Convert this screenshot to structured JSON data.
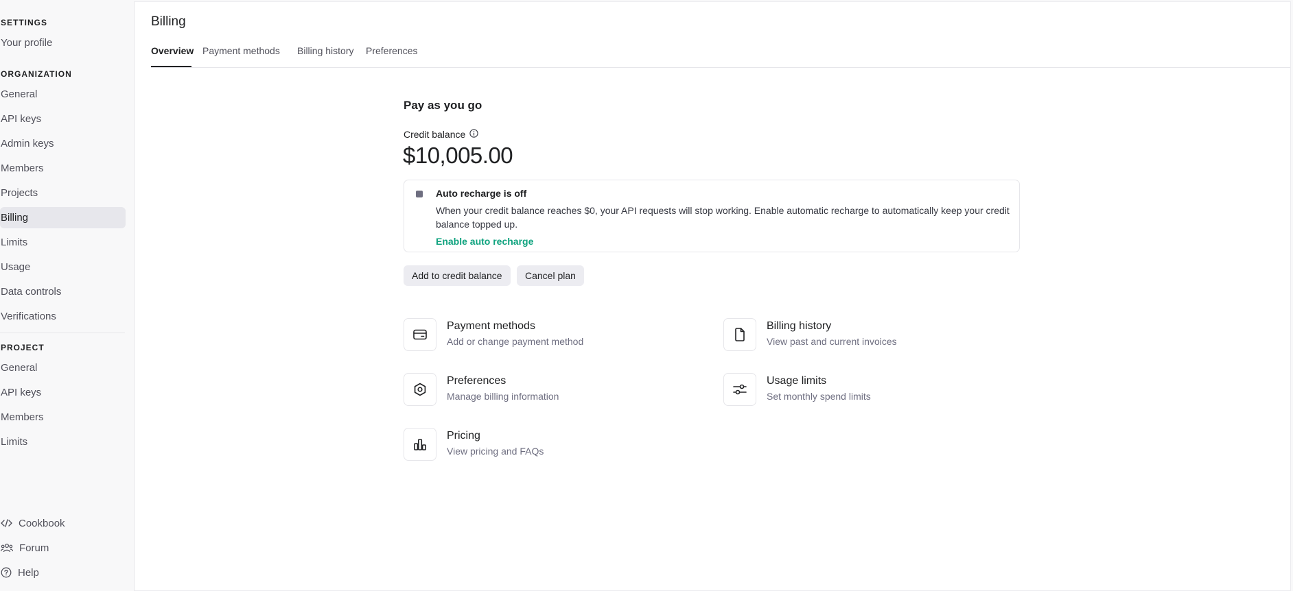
{
  "sidebar": {
    "settings_heading": "SETTINGS",
    "your_profile": "Your profile",
    "organization_heading": "ORGANIZATION",
    "org_items": [
      "General",
      "API keys",
      "Admin keys",
      "Members",
      "Projects",
      "Billing",
      "Limits",
      "Usage",
      "Data controls",
      "Verifications"
    ],
    "project_heading": "PROJECT",
    "project_items": [
      "General",
      "API keys",
      "Members",
      "Limits"
    ],
    "footer": {
      "cookbook": "Cookbook",
      "forum": "Forum",
      "help": "Help"
    }
  },
  "header": {
    "title": "Billing",
    "tabs": [
      "Overview",
      "Payment methods",
      "Billing history",
      "Preferences"
    ],
    "active_tab": "Overview"
  },
  "plan": {
    "title": "Pay as you go",
    "credit_label": "Credit balance",
    "balance": "$10,005.00"
  },
  "notice": {
    "title": "Auto recharge is off",
    "text": "When your credit balance reaches $0, your API requests will stop working. Enable automatic recharge to automatically keep your credit balance topped up.",
    "link": "Enable auto recharge"
  },
  "actions": {
    "add_credit": "Add to credit balance",
    "cancel_plan": "Cancel plan"
  },
  "cards": [
    {
      "title": "Payment methods",
      "desc": "Add or change payment method",
      "icon": "card-icon"
    },
    {
      "title": "Billing history",
      "desc": "View past and current invoices",
      "icon": "document-icon"
    },
    {
      "title": "Preferences",
      "desc": "Manage billing information",
      "icon": "gear-icon"
    },
    {
      "title": "Usage limits",
      "desc": "Set monthly spend limits",
      "icon": "sliders-icon"
    },
    {
      "title": "Pricing",
      "desc": "View pricing and FAQs",
      "icon": "bar-chart-icon"
    }
  ],
  "colors": {
    "accent": "#10a37f",
    "active_bg": "#e7e7ec",
    "text": "#202123",
    "muted": "#6e6e80"
  }
}
